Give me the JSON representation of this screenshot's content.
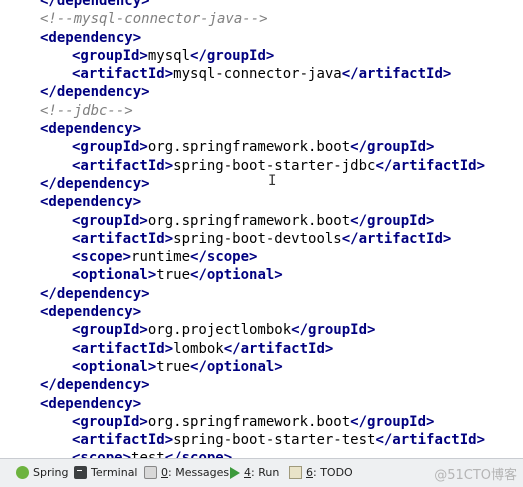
{
  "editor": {
    "lines": [
      {
        "kind": "tag",
        "indent": 0,
        "close": true,
        "tag": "dependency"
      },
      {
        "kind": "comment",
        "indent": 0,
        "text": "<!--mysql-connector-java-->"
      },
      {
        "kind": "tag",
        "indent": 0,
        "close": false,
        "tag": "dependency"
      },
      {
        "kind": "elem",
        "indent": 1,
        "tag": "groupId",
        "value": "mysql"
      },
      {
        "kind": "elem",
        "indent": 1,
        "tag": "artifactId",
        "value": "mysql-connector-java"
      },
      {
        "kind": "tag",
        "indent": 0,
        "close": true,
        "tag": "dependency"
      },
      {
        "kind": "comment",
        "indent": 0,
        "text": "<!--jdbc-->"
      },
      {
        "kind": "tag",
        "indent": 0,
        "close": false,
        "tag": "dependency"
      },
      {
        "kind": "elem",
        "indent": 1,
        "tag": "groupId",
        "value": "org.springframework.boot"
      },
      {
        "kind": "elem",
        "indent": 1,
        "tag": "artifactId",
        "value": "spring-boot-starter-jdbc"
      },
      {
        "kind": "tag",
        "indent": 0,
        "close": true,
        "tag": "dependency"
      },
      {
        "kind": "tag",
        "indent": 0,
        "close": false,
        "tag": "dependency"
      },
      {
        "kind": "elem",
        "indent": 1,
        "tag": "groupId",
        "value": "org.springframework.boot"
      },
      {
        "kind": "elem",
        "indent": 1,
        "tag": "artifactId",
        "value": "spring-boot-devtools"
      },
      {
        "kind": "elem",
        "indent": 1,
        "tag": "scope",
        "value": "runtime"
      },
      {
        "kind": "elem",
        "indent": 1,
        "tag": "optional",
        "value": "true"
      },
      {
        "kind": "tag",
        "indent": 0,
        "close": true,
        "tag": "dependency"
      },
      {
        "kind": "tag",
        "indent": 0,
        "close": false,
        "tag": "dependency"
      },
      {
        "kind": "elem",
        "indent": 1,
        "tag": "groupId",
        "value": "org.projectlombok"
      },
      {
        "kind": "elem",
        "indent": 1,
        "tag": "artifactId",
        "value": "lombok"
      },
      {
        "kind": "elem",
        "indent": 1,
        "tag": "optional",
        "value": "true"
      },
      {
        "kind": "tag",
        "indent": 0,
        "close": true,
        "tag": "dependency"
      },
      {
        "kind": "tag",
        "indent": 0,
        "close": false,
        "tag": "dependency"
      },
      {
        "kind": "elem",
        "indent": 1,
        "tag": "groupId",
        "value": "org.springframework.boot"
      },
      {
        "kind": "elem",
        "indent": 1,
        "tag": "artifactId",
        "value": "spring-boot-starter-test"
      },
      {
        "kind": "elem",
        "indent": 1,
        "tag": "scope",
        "value": "test"
      }
    ]
  },
  "status_bar": {
    "spring": "Spring",
    "terminal": "Terminal",
    "messages_num": "0",
    "messages_label": ": Messages",
    "run_num": "4",
    "run_label": ": Run",
    "todo_num": "6",
    "todo_label": ": TODO"
  },
  "watermark": "@51CTO博客",
  "colors": {
    "tag": "#000080",
    "comment": "#808080",
    "text": "#000000",
    "status_bg": "#eef0f2"
  }
}
